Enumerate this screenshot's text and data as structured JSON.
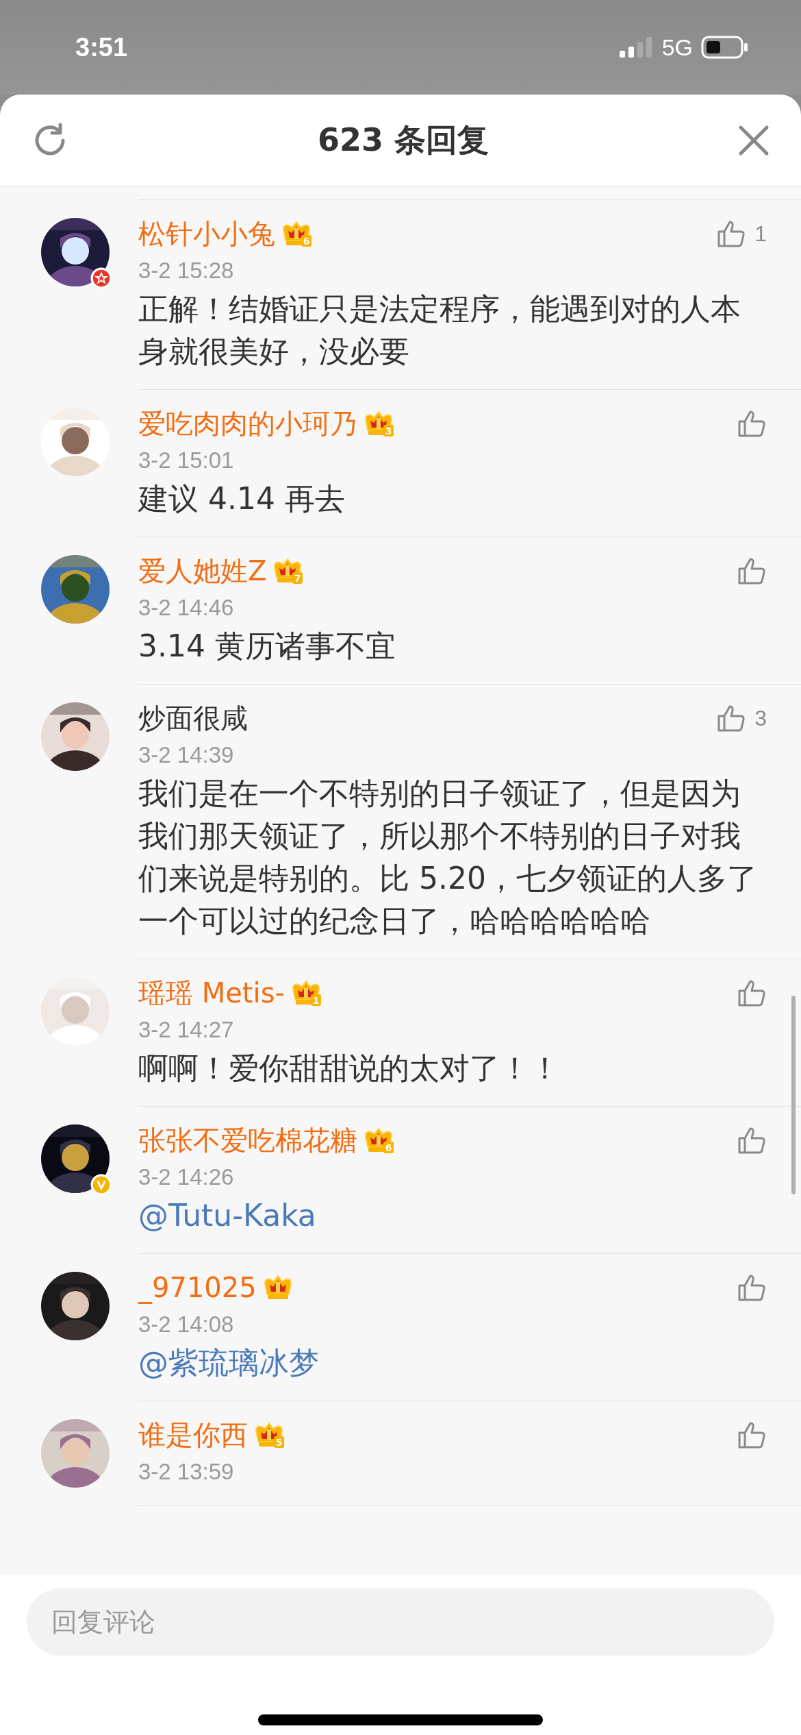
{
  "status_bar": {
    "time": "3:51",
    "network": "5G"
  },
  "header": {
    "title": "623 条回复"
  },
  "comments": [
    {
      "name": "松针小小兔",
      "vip": true,
      "vip_level": "6",
      "starred": true,
      "time": "3-2 15:28",
      "kind": "text",
      "text": "正解！结婚证只是法定程序，能遇到对的人本身就很美好，没必要",
      "likes": "1"
    },
    {
      "name": "爱吃肉肉的小珂乃",
      "vip": true,
      "vip_level": "3",
      "time": "3-2 15:01",
      "kind": "text",
      "text": "建议 4.14 再去"
    },
    {
      "name": "爱人她姓Z",
      "vip": true,
      "vip_level": "7",
      "time": "3-2 14:46",
      "kind": "text",
      "text": "3.14 黄历诸事不宜"
    },
    {
      "name": "炒面很咸",
      "vip": false,
      "time": "3-2 14:39",
      "kind": "text",
      "text": "我们是在一个不特别的日子领证了，但是因为我们那天领证了，所以那个不特别的日子对我们来说是特别的。比 5.20，七夕领证的人多了一个可以过的纪念日了，哈哈哈哈哈哈",
      "likes": "3"
    },
    {
      "name": "瑶瑶 Metis-",
      "vip": true,
      "vip_level": "1",
      "time": "3-2 14:27",
      "kind": "text",
      "text": "啊啊！爱你甜甜说的太对了！！"
    },
    {
      "name": "张张不爱吃棉花糖",
      "vip": true,
      "vip_level": "6",
      "verified": true,
      "time": "3-2 14:26",
      "kind": "mention",
      "text": "@Tutu-Kaka"
    },
    {
      "name": "_971025",
      "vip": true,
      "time": "3-2 14:08",
      "kind": "mention",
      "text": "@紫琉璃冰梦"
    },
    {
      "name": "谁是你西",
      "vip": true,
      "vip_level": "5",
      "time": "3-2 13:59"
    }
  ],
  "reply_field": {
    "placeholder": "回复评论"
  }
}
